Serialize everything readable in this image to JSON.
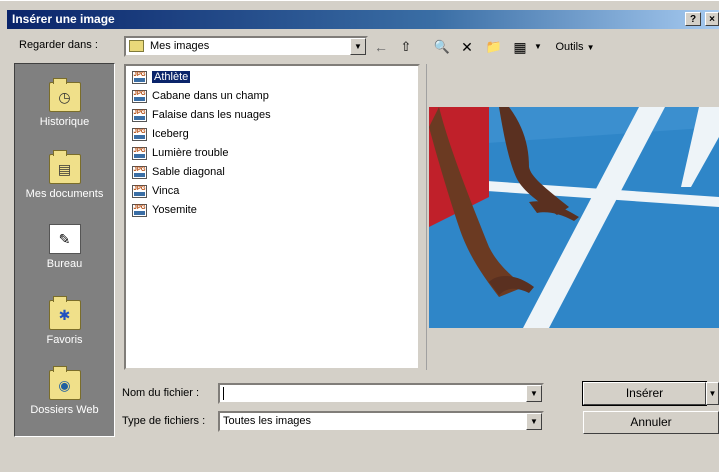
{
  "window": {
    "title": "Insérer une image",
    "help_glyph": "?",
    "close_glyph": "×"
  },
  "lookin": {
    "label": "Regarder dans :",
    "value": "Mes images"
  },
  "toolbar": {
    "back": "←",
    "up": "⇧",
    "search": "🔍",
    "delete": "✕",
    "new_folder": "📁",
    "views": "▦",
    "tools_label": "Outils"
  },
  "places": [
    {
      "label": "Historique",
      "glyph": "◷"
    },
    {
      "label": "Mes documents",
      "glyph": "▤"
    },
    {
      "label": "Bureau",
      "glyph": "✎"
    },
    {
      "label": "Favoris",
      "glyph": "✱"
    },
    {
      "label": "Dossiers Web",
      "glyph": "◉"
    }
  ],
  "files": [
    {
      "name": "Athlète",
      "selected": true
    },
    {
      "name": "Cabane dans un champ"
    },
    {
      "name": "Falaise dans les nuages"
    },
    {
      "name": "Iceberg"
    },
    {
      "name": "Lumière trouble"
    },
    {
      "name": "Sable diagonal"
    },
    {
      "name": "Vinca"
    },
    {
      "name": "Yosemite"
    }
  ],
  "file_icon_text": "JPG",
  "filename": {
    "label": "Nom du fichier :",
    "value": ""
  },
  "filetype": {
    "label": "Type de fichiers :",
    "value": "Toutes les images"
  },
  "buttons": {
    "insert": "Insérer",
    "cancel": "Annuler"
  },
  "colors": {
    "title_start": "#0a246a",
    "title_end": "#a6caf0",
    "track": "#2f86c8",
    "selection": "#0a246a"
  }
}
